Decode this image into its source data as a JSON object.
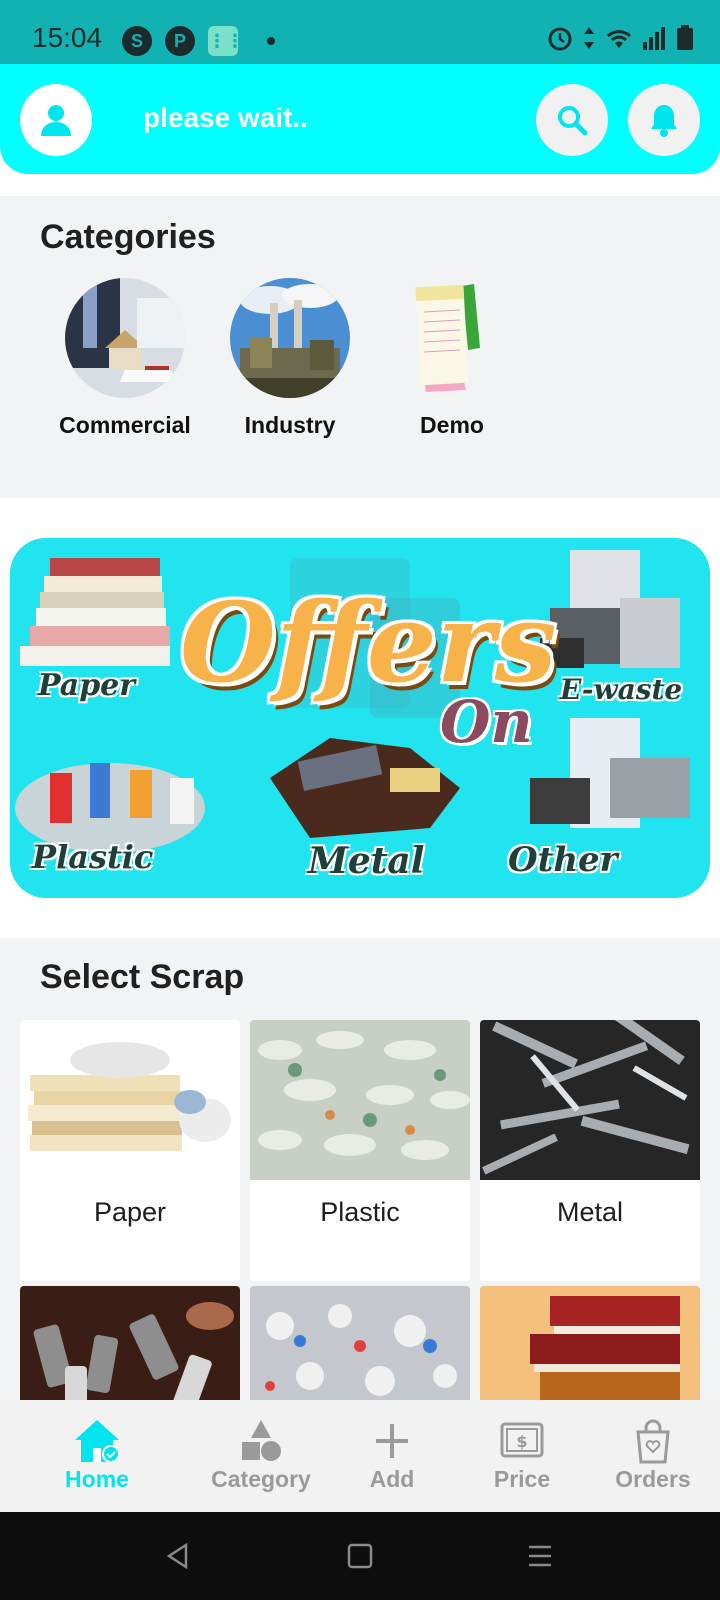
{
  "status_bar": {
    "time": "15:04",
    "apps": [
      "S",
      "P",
      "⋮⋮"
    ]
  },
  "header": {
    "title": "please wait..",
    "accent": "#00ffff",
    "icons": [
      "user-icon",
      "search-icon",
      "bell-icon"
    ]
  },
  "categories": {
    "title": "Categories",
    "items": [
      {
        "label": "Commercial",
        "icon": "commercial-photo"
      },
      {
        "label": "Industry",
        "icon": "industry-photo"
      },
      {
        "label": "Demo",
        "icon": "notepad-photo"
      }
    ]
  },
  "banner": {
    "headline": "Offers",
    "subline": "On",
    "words": [
      "Paper",
      "E-waste",
      "Plastic",
      "Metal",
      "Other"
    ]
  },
  "select_scrap": {
    "title": "Select Scrap",
    "tiles": [
      {
        "label": "Paper"
      },
      {
        "label": "Plastic"
      },
      {
        "label": "Metal"
      },
      {
        "label": ""
      },
      {
        "label": ""
      },
      {
        "label": ""
      }
    ]
  },
  "bottom_nav": {
    "items": [
      {
        "label": "Home",
        "icon": "home-icon",
        "active": true
      },
      {
        "label": "Category",
        "icon": "shapes-icon",
        "active": false
      },
      {
        "label": "Add",
        "icon": "plus-icon",
        "active": false
      },
      {
        "label": "Price",
        "icon": "price-tag-icon",
        "active": false
      },
      {
        "label": "Orders",
        "icon": "shopping-bag-icon",
        "active": false
      }
    ],
    "active_color": "#00e5f0",
    "inactive_color": "#9a9a9a"
  }
}
